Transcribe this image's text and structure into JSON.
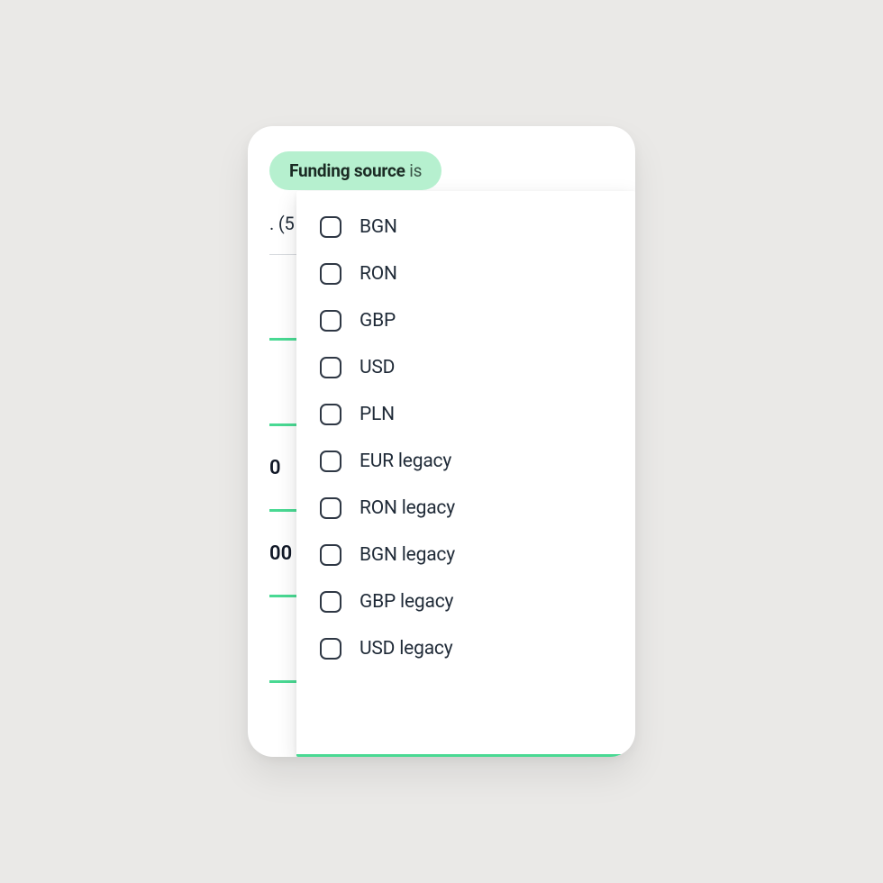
{
  "filter": {
    "label_bold": "Funding source",
    "label_suffix": " is"
  },
  "background": {
    "partial_text": ". (5",
    "rows": [
      "",
      "",
      "0",
      "00",
      ""
    ]
  },
  "options": [
    {
      "label": "BGN",
      "checked": false
    },
    {
      "label": "RON",
      "checked": false
    },
    {
      "label": "GBP",
      "checked": false
    },
    {
      "label": "USD",
      "checked": false
    },
    {
      "label": "PLN",
      "checked": false
    },
    {
      "label": "EUR legacy",
      "checked": false
    },
    {
      "label": "RON legacy",
      "checked": false
    },
    {
      "label": "BGN legacy",
      "checked": false
    },
    {
      "label": "GBP legacy",
      "checked": false
    },
    {
      "label": "USD legacy",
      "checked": false
    }
  ]
}
